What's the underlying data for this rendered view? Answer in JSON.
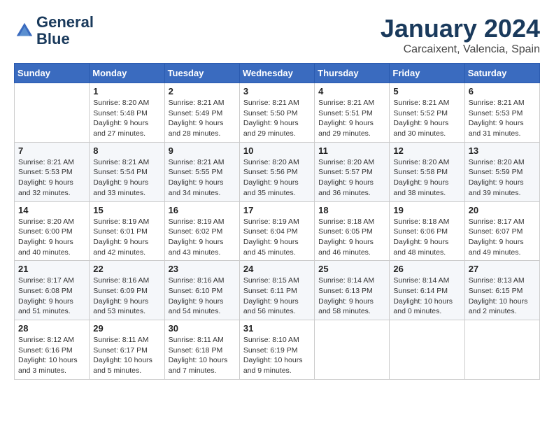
{
  "header": {
    "logo_line1": "General",
    "logo_line2": "Blue",
    "month_title": "January 2024",
    "location": "Carcaixent, Valencia, Spain"
  },
  "weekdays": [
    "Sunday",
    "Monday",
    "Tuesday",
    "Wednesday",
    "Thursday",
    "Friday",
    "Saturday"
  ],
  "weeks": [
    [
      {
        "day": "",
        "info": ""
      },
      {
        "day": "1",
        "info": "Sunrise: 8:20 AM\nSunset: 5:48 PM\nDaylight: 9 hours\nand 27 minutes."
      },
      {
        "day": "2",
        "info": "Sunrise: 8:21 AM\nSunset: 5:49 PM\nDaylight: 9 hours\nand 28 minutes."
      },
      {
        "day": "3",
        "info": "Sunrise: 8:21 AM\nSunset: 5:50 PM\nDaylight: 9 hours\nand 29 minutes."
      },
      {
        "day": "4",
        "info": "Sunrise: 8:21 AM\nSunset: 5:51 PM\nDaylight: 9 hours\nand 29 minutes."
      },
      {
        "day": "5",
        "info": "Sunrise: 8:21 AM\nSunset: 5:52 PM\nDaylight: 9 hours\nand 30 minutes."
      },
      {
        "day": "6",
        "info": "Sunrise: 8:21 AM\nSunset: 5:53 PM\nDaylight: 9 hours\nand 31 minutes."
      }
    ],
    [
      {
        "day": "7",
        "info": "Sunrise: 8:21 AM\nSunset: 5:53 PM\nDaylight: 9 hours\nand 32 minutes."
      },
      {
        "day": "8",
        "info": "Sunrise: 8:21 AM\nSunset: 5:54 PM\nDaylight: 9 hours\nand 33 minutes."
      },
      {
        "day": "9",
        "info": "Sunrise: 8:21 AM\nSunset: 5:55 PM\nDaylight: 9 hours\nand 34 minutes."
      },
      {
        "day": "10",
        "info": "Sunrise: 8:20 AM\nSunset: 5:56 PM\nDaylight: 9 hours\nand 35 minutes."
      },
      {
        "day": "11",
        "info": "Sunrise: 8:20 AM\nSunset: 5:57 PM\nDaylight: 9 hours\nand 36 minutes."
      },
      {
        "day": "12",
        "info": "Sunrise: 8:20 AM\nSunset: 5:58 PM\nDaylight: 9 hours\nand 38 minutes."
      },
      {
        "day": "13",
        "info": "Sunrise: 8:20 AM\nSunset: 5:59 PM\nDaylight: 9 hours\nand 39 minutes."
      }
    ],
    [
      {
        "day": "14",
        "info": "Sunrise: 8:20 AM\nSunset: 6:00 PM\nDaylight: 9 hours\nand 40 minutes."
      },
      {
        "day": "15",
        "info": "Sunrise: 8:19 AM\nSunset: 6:01 PM\nDaylight: 9 hours\nand 42 minutes."
      },
      {
        "day": "16",
        "info": "Sunrise: 8:19 AM\nSunset: 6:02 PM\nDaylight: 9 hours\nand 43 minutes."
      },
      {
        "day": "17",
        "info": "Sunrise: 8:19 AM\nSunset: 6:04 PM\nDaylight: 9 hours\nand 45 minutes."
      },
      {
        "day": "18",
        "info": "Sunrise: 8:18 AM\nSunset: 6:05 PM\nDaylight: 9 hours\nand 46 minutes."
      },
      {
        "day": "19",
        "info": "Sunrise: 8:18 AM\nSunset: 6:06 PM\nDaylight: 9 hours\nand 48 minutes."
      },
      {
        "day": "20",
        "info": "Sunrise: 8:17 AM\nSunset: 6:07 PM\nDaylight: 9 hours\nand 49 minutes."
      }
    ],
    [
      {
        "day": "21",
        "info": "Sunrise: 8:17 AM\nSunset: 6:08 PM\nDaylight: 9 hours\nand 51 minutes."
      },
      {
        "day": "22",
        "info": "Sunrise: 8:16 AM\nSunset: 6:09 PM\nDaylight: 9 hours\nand 53 minutes."
      },
      {
        "day": "23",
        "info": "Sunrise: 8:16 AM\nSunset: 6:10 PM\nDaylight: 9 hours\nand 54 minutes."
      },
      {
        "day": "24",
        "info": "Sunrise: 8:15 AM\nSunset: 6:11 PM\nDaylight: 9 hours\nand 56 minutes."
      },
      {
        "day": "25",
        "info": "Sunrise: 8:14 AM\nSunset: 6:13 PM\nDaylight: 9 hours\nand 58 minutes."
      },
      {
        "day": "26",
        "info": "Sunrise: 8:14 AM\nSunset: 6:14 PM\nDaylight: 10 hours\nand 0 minutes."
      },
      {
        "day": "27",
        "info": "Sunrise: 8:13 AM\nSunset: 6:15 PM\nDaylight: 10 hours\nand 2 minutes."
      }
    ],
    [
      {
        "day": "28",
        "info": "Sunrise: 8:12 AM\nSunset: 6:16 PM\nDaylight: 10 hours\nand 3 minutes."
      },
      {
        "day": "29",
        "info": "Sunrise: 8:11 AM\nSunset: 6:17 PM\nDaylight: 10 hours\nand 5 minutes."
      },
      {
        "day": "30",
        "info": "Sunrise: 8:11 AM\nSunset: 6:18 PM\nDaylight: 10 hours\nand 7 minutes."
      },
      {
        "day": "31",
        "info": "Sunrise: 8:10 AM\nSunset: 6:19 PM\nDaylight: 10 hours\nand 9 minutes."
      },
      {
        "day": "",
        "info": ""
      },
      {
        "day": "",
        "info": ""
      },
      {
        "day": "",
        "info": ""
      }
    ]
  ]
}
